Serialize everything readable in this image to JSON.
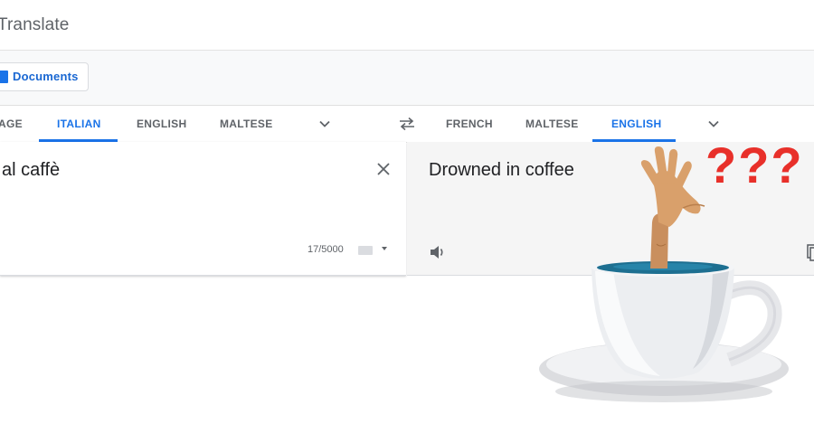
{
  "header": {
    "title": "Translate"
  },
  "modes": {
    "documents_label": "Documents"
  },
  "source_langs": [
    "AGE",
    "ITALIAN",
    "ENGLISH",
    "MALTESE"
  ],
  "target_langs": [
    "FRENCH",
    "MALTESE",
    "ENGLISH"
  ],
  "source": {
    "text": "al caffè",
    "char_count": "17/5000"
  },
  "target": {
    "text": "Drowned in coffee"
  },
  "meme": {
    "text": "???"
  },
  "icons": {
    "doc": "document-icon",
    "swap": "swap-arrows-icon",
    "chevron": "chevron-down-icon",
    "clear": "close-icon",
    "keyboard": "keyboard-icon",
    "speaker": "speaker-icon",
    "copy": "copy-icon"
  },
  "colors": {
    "accent": "#1a73e8",
    "meme_text": "#e8302a",
    "target_bg": "#f5f5f5"
  }
}
